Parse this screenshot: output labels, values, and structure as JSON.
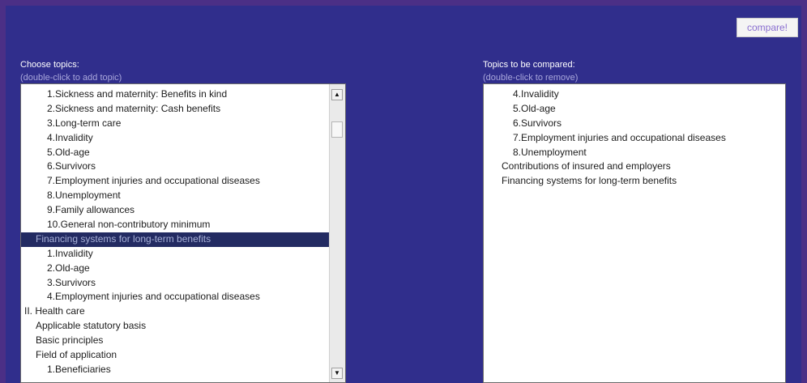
{
  "toolbar": {
    "compare_label": "compare!"
  },
  "left_panel": {
    "title": "Choose topics:",
    "hint": "(double-click to add topic)",
    "items": [
      {
        "label": "1.Sickness and maternity: Benefits in kind",
        "indent": 2
      },
      {
        "label": "2.Sickness and maternity: Cash benefits",
        "indent": 2
      },
      {
        "label": "3.Long-term care",
        "indent": 2
      },
      {
        "label": "4.Invalidity",
        "indent": 2
      },
      {
        "label": "5.Old-age",
        "indent": 2
      },
      {
        "label": "6.Survivors",
        "indent": 2
      },
      {
        "label": "7.Employment injuries and occupational diseases",
        "indent": 2
      },
      {
        "label": "8.Unemployment",
        "indent": 2
      },
      {
        "label": "9.Family allowances",
        "indent": 2
      },
      {
        "label": "10.General non-contributory minimum",
        "indent": 2
      },
      {
        "label": "Financing systems for long-term benefits",
        "indent": 1,
        "selected": true
      },
      {
        "label": "1.Invalidity",
        "indent": 2
      },
      {
        "label": "2.Old-age",
        "indent": 2
      },
      {
        "label": "3.Survivors",
        "indent": 2
      },
      {
        "label": "4.Employment injuries and occupational diseases",
        "indent": 2
      },
      {
        "label": "II. Health care",
        "indent": 0
      },
      {
        "label": "Applicable statutory basis",
        "indent": 1
      },
      {
        "label": "Basic principles",
        "indent": 1
      },
      {
        "label": "Field of application",
        "indent": 1
      },
      {
        "label": "1.Beneficiaries",
        "indent": 2
      }
    ]
  },
  "right_panel": {
    "title": "Topics to be compared:",
    "hint": "(double-click to remove)",
    "items": [
      {
        "label": "4.Invalidity",
        "indent": 2
      },
      {
        "label": "5.Old-age",
        "indent": 2
      },
      {
        "label": "6.Survivors",
        "indent": 2
      },
      {
        "label": "7.Employment injuries and occupational diseases",
        "indent": 2
      },
      {
        "label": "8.Unemployment",
        "indent": 2
      },
      {
        "label": "Contributions of insured and employers",
        "indent": 1
      },
      {
        "label": "Financing systems for long-term benefits",
        "indent": 1
      }
    ]
  },
  "colors": {
    "background": "#302e8c",
    "frame": "#4b2f86",
    "selection": "#232b62",
    "selection_text": "#a8b1d8"
  },
  "icons": {
    "scroll_up": "arrow-up-icon",
    "scroll_down": "arrow-down-icon"
  }
}
